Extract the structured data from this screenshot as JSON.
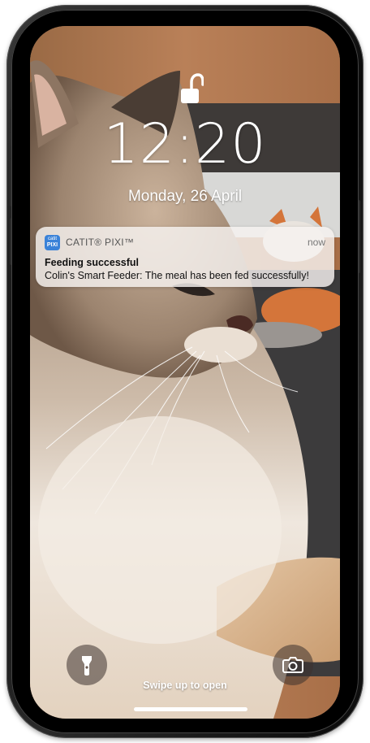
{
  "lock_screen": {
    "time": "12:20",
    "date": "Monday, 26 April",
    "lock_icon": "unlocked-padlock-icon"
  },
  "notification": {
    "app_icon": "catit-pixi-app-icon",
    "app_icon_text_top": "catit",
    "app_icon_text_bottom": "PIXI",
    "app_name": "CATIT® PIXI™",
    "time": "now",
    "title": "Feeding successful",
    "body": "Colin's Smart Feeder: The meal has been fed successfully!"
  },
  "controls": {
    "flashlight_icon": "flashlight-icon",
    "camera_icon": "camera-icon",
    "swipe_hint": "Swipe up to open"
  },
  "colors": {
    "app_icon_bg": "#3a82d8",
    "notification_bg": "#f6f3f0",
    "text_white": "#ffffff"
  }
}
